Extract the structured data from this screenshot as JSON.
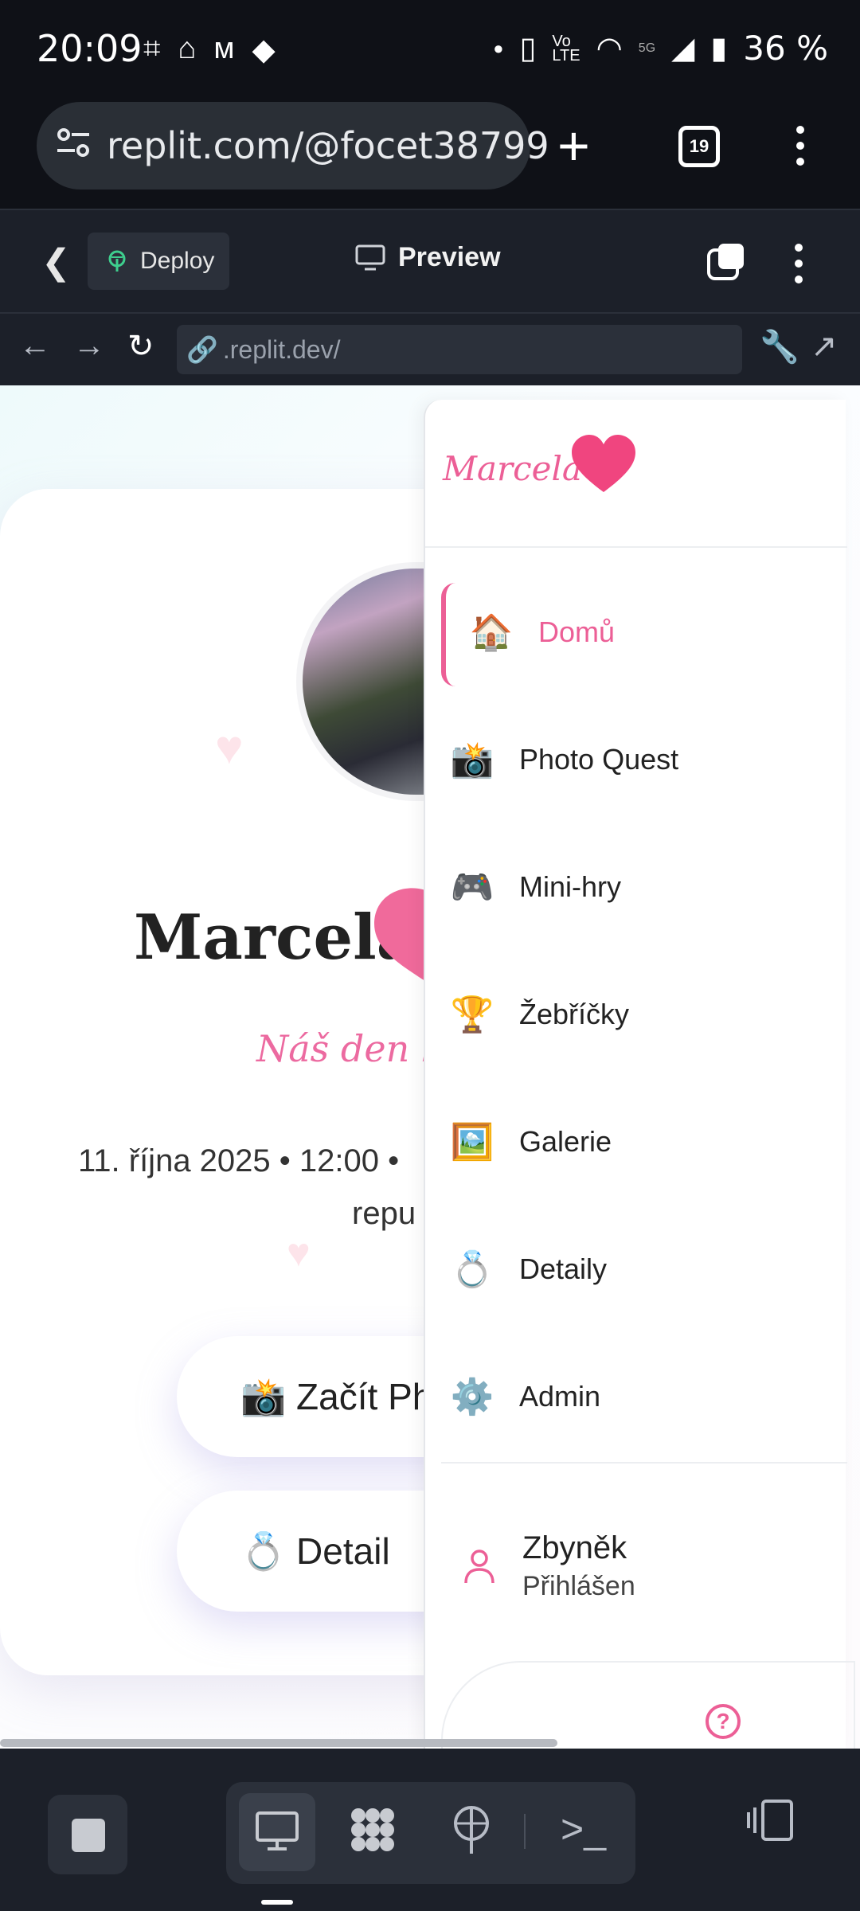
{
  "status_bar": {
    "time": "20:09",
    "battery": "36 %",
    "network": "5G"
  },
  "browser": {
    "url": "replit.com/@focet38799",
    "tab_count": "19"
  },
  "replit_toolbar": {
    "deploy_label": "Deploy",
    "preview_label": "Preview"
  },
  "webview_nav": {
    "address": ".replit.dev/"
  },
  "page": {
    "title": "Marcela",
    "subtitle": "Náš den lás",
    "date_line": "11. října 2025 • 12:00 •",
    "date_line_2": "repu",
    "cta_primary": "📸 Začít Ph",
    "cta_secondary": "💍 Detail"
  },
  "menu": {
    "brand": "Marcela",
    "items": [
      {
        "icon": "🏠",
        "label": "Domů",
        "active": true
      },
      {
        "icon": "📸",
        "label": "Photo Quest"
      },
      {
        "icon": "🎮",
        "label": "Mini-hry"
      },
      {
        "icon": "🏆",
        "label": "Žebříčky"
      },
      {
        "icon": "🖼️",
        "label": "Galerie"
      },
      {
        "icon": "💍",
        "label": "Detaily"
      },
      {
        "icon": "⚙️",
        "label": "Admin"
      }
    ],
    "user": {
      "name": "Zbyněk",
      "status": "Přihlášen"
    }
  },
  "colors": {
    "accent": "#ec5f96",
    "dark_bg": "#0f1117",
    "toolbar_bg": "#1c2029"
  }
}
